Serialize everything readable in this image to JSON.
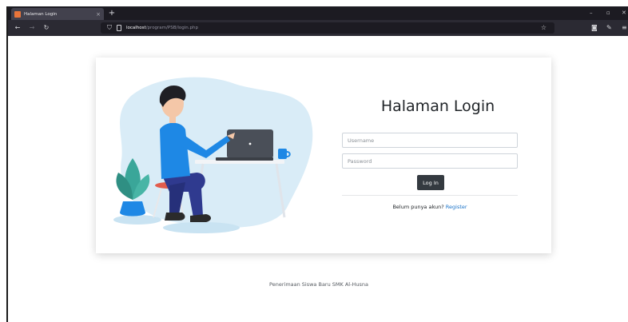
{
  "browser": {
    "tab_title": "Halaman Login",
    "tab_close": "×",
    "new_tab": "+",
    "url_host": "localhost",
    "url_path": "/program/PSB/login.php",
    "window_controls": [
      "–",
      "▫",
      "✕"
    ]
  },
  "login": {
    "title": "Halaman Login",
    "username_placeholder": "Username",
    "password_placeholder": "Password",
    "button_label": "Log In",
    "register_prompt": "Belum punya akun?",
    "register_link": "Register"
  },
  "footer": {
    "text": "Penerimaan Siswa Baru SMK Al-Husna"
  },
  "colors": {
    "tabbar_bg": "#1c1b22",
    "navbar_bg": "#2b2a33",
    "button_bg": "#343a40",
    "link": "#1a73c8",
    "illustration_blob": "#d9ecf7",
    "shirt": "#1e88e5",
    "pants": "#2f3a8f"
  },
  "icons": [
    "back-arrow-icon",
    "forward-arrow-icon",
    "reload-icon",
    "shield-icon",
    "page-icon",
    "bookmark-star-icon",
    "pocket-icon",
    "extensions-icon",
    "menu-icon"
  ]
}
